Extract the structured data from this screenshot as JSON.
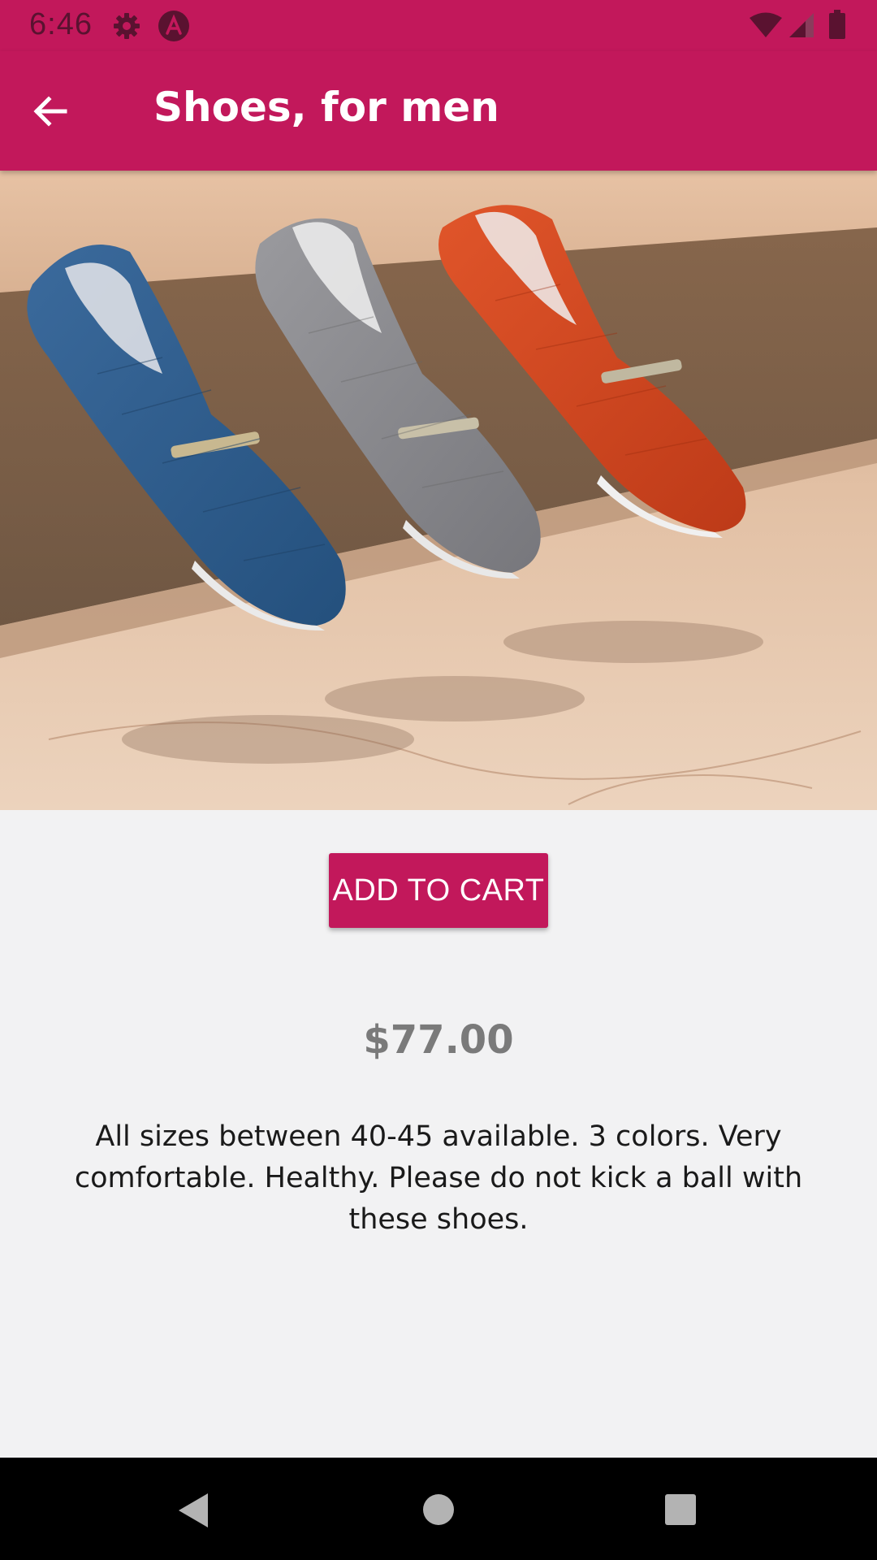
{
  "status_bar": {
    "time": "6:46",
    "icons": [
      "gear-icon",
      "app-notification-icon",
      "wifi-icon",
      "signal-icon",
      "battery-icon"
    ]
  },
  "app_bar": {
    "title": "Shoes, for men",
    "back_icon": "arrow-back-icon"
  },
  "product": {
    "image_subject": "product-photo-shoes",
    "add_to_cart_label": "ADD TO CART",
    "price": "$77.00",
    "description": "All sizes between 40-45 available. 3 colors. Very comfortable. Healthy. Please do not kick a ball with these shoes."
  },
  "nav_bar": {
    "icons": [
      "nav-back-icon",
      "nav-home-icon",
      "nav-recents-icon"
    ]
  },
  "colors": {
    "primary": "#c2185b",
    "status_icons": "#5a1230",
    "background": "#f2f2f3",
    "price_text": "#7a7a7a",
    "nav_bar": "#000000"
  }
}
